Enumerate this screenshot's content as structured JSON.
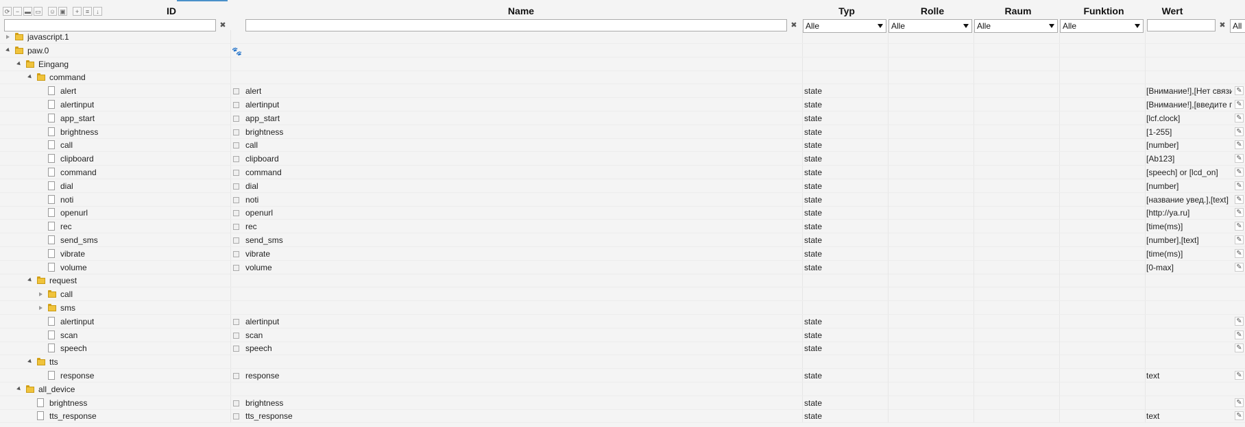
{
  "toolbar": {
    "buttons": [
      "refresh-icon",
      "collapse-all-icon",
      "folder-closed-icon",
      "folder-open-icon",
      "user-icon",
      "card-icon",
      "add-icon",
      "sort-icon",
      "download-icon"
    ]
  },
  "columns": {
    "id": "ID",
    "name": "Name",
    "typ": "Typ",
    "rolle": "Rolle",
    "raum": "Raum",
    "funktion": "Funktion",
    "wert": "Wert"
  },
  "filters": {
    "typ": "Alle",
    "rolle": "Alle",
    "raum": "Alle",
    "funktion": "Alle",
    "extra": "All"
  },
  "rows": [
    {
      "id": "javascript.1",
      "name": "",
      "typ": "",
      "wert": "",
      "kind": "folder",
      "depth": 0,
      "exp": "closed"
    },
    {
      "id": "paw.0",
      "name": "",
      "typ": "",
      "wert": "",
      "kind": "folder",
      "depth": 0,
      "exp": "open",
      "paw": true
    },
    {
      "id": "Eingang",
      "name": "",
      "typ": "",
      "wert": "",
      "kind": "folder",
      "depth": 1,
      "exp": "open"
    },
    {
      "id": "command",
      "name": "",
      "typ": "",
      "wert": "",
      "kind": "folder",
      "depth": 2,
      "exp": "open"
    },
    {
      "id": "alert",
      "name": "alert",
      "typ": "state",
      "wert": "[Внимание!],[Нет связи",
      "kind": "file",
      "depth": 3
    },
    {
      "id": "alertinput",
      "name": "alertinput",
      "typ": "state",
      "wert": "[Внимание!],[введите п",
      "kind": "file",
      "depth": 3
    },
    {
      "id": "app_start",
      "name": "app_start",
      "typ": "state",
      "wert": "[lcf.clock]",
      "kind": "file",
      "depth": 3
    },
    {
      "id": "brightness",
      "name": "brightness",
      "typ": "state",
      "wert": "[1-255]",
      "kind": "file",
      "depth": 3
    },
    {
      "id": "call",
      "name": "call",
      "typ": "state",
      "wert": "[number]",
      "kind": "file",
      "depth": 3
    },
    {
      "id": "clipboard",
      "name": "clipboard",
      "typ": "state",
      "wert": "[Ab123]",
      "kind": "file",
      "depth": 3
    },
    {
      "id": "command",
      "name": "command",
      "typ": "state",
      "wert": "[speech] or [lcd_on]",
      "kind": "file",
      "depth": 3
    },
    {
      "id": "dial",
      "name": "dial",
      "typ": "state",
      "wert": "[number]",
      "kind": "file",
      "depth": 3
    },
    {
      "id": "noti",
      "name": "noti",
      "typ": "state",
      "wert": "[название увед.],[text]",
      "kind": "file",
      "depth": 3
    },
    {
      "id": "openurl",
      "name": "openurl",
      "typ": "state",
      "wert": "[http://ya.ru]",
      "kind": "file",
      "depth": 3
    },
    {
      "id": "rec",
      "name": "rec",
      "typ": "state",
      "wert": "[time(ms)]",
      "kind": "file",
      "depth": 3
    },
    {
      "id": "send_sms",
      "name": "send_sms",
      "typ": "state",
      "wert": "[number],[text]",
      "kind": "file",
      "depth": 3
    },
    {
      "id": "vibrate",
      "name": "vibrate",
      "typ": "state",
      "wert": "[time(ms)]",
      "kind": "file",
      "depth": 3
    },
    {
      "id": "volume",
      "name": "volume",
      "typ": "state",
      "wert": "[0-max]",
      "kind": "file",
      "depth": 3
    },
    {
      "id": "request",
      "name": "",
      "typ": "",
      "wert": "",
      "kind": "folder",
      "depth": 2,
      "exp": "open"
    },
    {
      "id": "call",
      "name": "",
      "typ": "",
      "wert": "",
      "kind": "folder",
      "depth": 3,
      "exp": "closed"
    },
    {
      "id": "sms",
      "name": "",
      "typ": "",
      "wert": "",
      "kind": "folder",
      "depth": 3,
      "exp": "closed"
    },
    {
      "id": "alertinput",
      "name": "alertinput",
      "typ": "state",
      "wert": "",
      "kind": "file",
      "depth": 3
    },
    {
      "id": "scan",
      "name": "scan",
      "typ": "state",
      "wert": "",
      "kind": "file",
      "depth": 3
    },
    {
      "id": "speech",
      "name": "speech",
      "typ": "state",
      "wert": "",
      "kind": "file",
      "depth": 3
    },
    {
      "id": "tts",
      "name": "",
      "typ": "",
      "wert": "",
      "kind": "folder",
      "depth": 2,
      "exp": "open"
    },
    {
      "id": "response",
      "name": "response",
      "typ": "state",
      "wert": "text",
      "kind": "file",
      "depth": 3
    },
    {
      "id": "all_device",
      "name": "",
      "typ": "",
      "wert": "",
      "kind": "folder",
      "depth": 1,
      "exp": "open"
    },
    {
      "id": "brightness",
      "name": "brightness",
      "typ": "state",
      "wert": "",
      "kind": "file",
      "depth": 2
    },
    {
      "id": "tts_response",
      "name": "tts_response",
      "typ": "state",
      "wert": "text",
      "kind": "file",
      "depth": 2
    }
  ]
}
